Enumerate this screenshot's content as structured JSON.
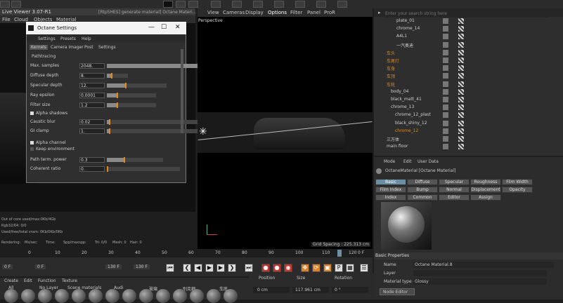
{
  "live_viewer": {
    "title": "Live Viewer 3.07-R1",
    "menu": [
      "File",
      "Cloud",
      "Objects",
      "Material"
    ],
    "info": [
      "Out of core used/max:0Kb/4Gb",
      "Rgb32/64: 0/0",
      "Used/free/total vram: 0Kb/0Kb/0Kb"
    ],
    "status": [
      "Rendering:",
      "Ms/sec:",
      "Time:",
      "Spp/maxspp:",
      "Tri: 0/0",
      "Mesh: 0",
      "Hair: 0"
    ]
  },
  "tab_strip": "[Rtp5HES] generate material] Octane Materi...",
  "octane_settings": {
    "title": "Octane Settings",
    "menu": [
      "Settings",
      "Presets",
      "Help"
    ],
    "tabs": [
      "Kernels",
      "Camera Imager",
      "Post",
      "Settings"
    ],
    "mode": "Pathtracing",
    "rows": [
      {
        "label": "Max. samples",
        "value": "2048.",
        "fill": 0.98
      },
      {
        "label": "Diffuse depth",
        "value": "8.",
        "fill": 0.2
      },
      {
        "label": "Specular depth",
        "value": "12.",
        "fill": 0.3
      },
      {
        "label": "Ray epsilon",
        "value": "0.0001",
        "fill": 0.2
      },
      {
        "label": "Filter size",
        "value": "1.2",
        "fill": 0.2
      }
    ],
    "alpha_shadows": "Alpha shadows",
    "rows2": [
      {
        "label": "Caustic blur",
        "value": "0.02",
        "fill": 0.02
      },
      {
        "label": "GI clamp",
        "value": "1.",
        "fill": 0.02
      }
    ],
    "checks": [
      "Alpha channel",
      "Keep environment"
    ],
    "rows3": [
      {
        "label": "Path term. power",
        "value": "0.3",
        "fill": 0.3
      },
      {
        "label": "Coherent ratio",
        "value": "0.",
        "fill": 0.0
      }
    ]
  },
  "viewport": {
    "menu": [
      "View",
      "Cameras",
      "Display",
      "Options",
      "Filter",
      "Panel",
      "ProR"
    ],
    "label": "Perspective",
    "grid": "Grid Spacing : 225.313 cm"
  },
  "object_manager": {
    "search_placeholder": "Enter your search string here",
    "items": [
      "plate_01",
      "chrome_14",
      "A4L1",
      "一汽奥迪",
      "车头",
      "车尾灯",
      "车身",
      "车顶",
      "车轮",
      "body_04",
      "black_matt_41",
      "chrome_13",
      "chrome_12_plast",
      "black_shiny_12",
      "chrome_12",
      "三万体",
      "main floor"
    ]
  },
  "attributes": {
    "menu": [
      "Mode",
      "Edit",
      "User Data"
    ],
    "material": "OctaneMaterial [Octane Material]",
    "tabs": [
      "Basic",
      "Diffuse",
      "Specular",
      "Roughness",
      "Film Width",
      "Film Index",
      "Bump",
      "Normal",
      "Displacement",
      "Opacity",
      "Index",
      "Common",
      "Editor",
      "Assign"
    ],
    "section": "Basic Properties",
    "name_label": "Name",
    "name_value": "Octane Material.8",
    "layer_label": "Layer",
    "material_type_label": "Material type",
    "material_type_value": "Glossy",
    "node_editor": "Node Editor"
  },
  "timeline": {
    "ticks": [
      "0",
      "10",
      "20",
      "30",
      "40",
      "50",
      "60",
      "70",
      "80",
      "90",
      "100",
      "110",
      "120"
    ],
    "frame": "0 F",
    "start": "0 F",
    "end": "130 F",
    "end2": "130 F"
  },
  "materials": {
    "menu": [
      "Create",
      "Edit",
      "Function",
      "Texture"
    ],
    "filters": [
      "All",
      "No Layer",
      "Scene materials",
      "Audi",
      "玻璃",
      "别克细",
      "车底"
    ]
  },
  "coordinates": {
    "headers": [
      "Position",
      "Size",
      "Rotation"
    ],
    "values": [
      "0 cm",
      "117.961 cm",
      "0 °"
    ]
  },
  "colors": {
    "accent": "#e08a1e",
    "selected_tab": "#6a8fa3",
    "red": "#c8322a"
  }
}
